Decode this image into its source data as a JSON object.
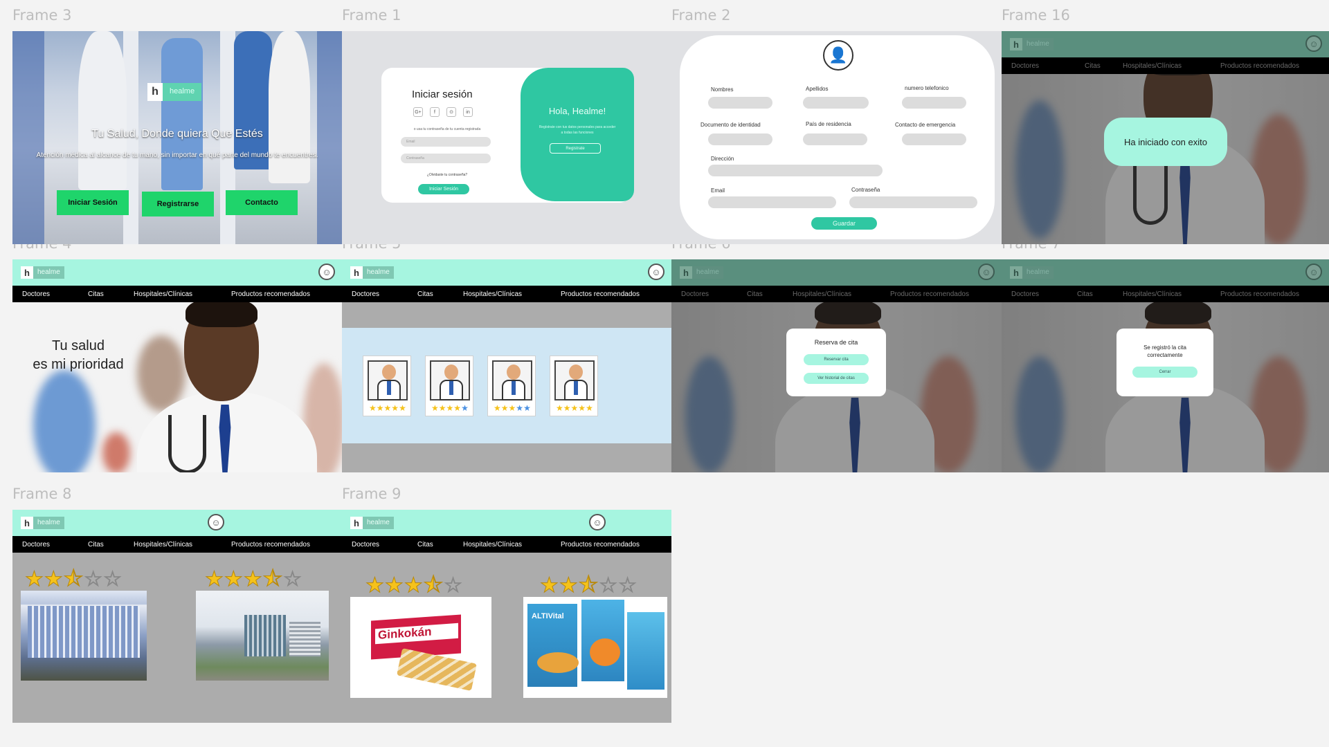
{
  "frame_labels": {
    "f3": "Frame 3",
    "f1": "Frame 1",
    "f2": "Frame 2",
    "f16": "Frame 16",
    "f4": "Frame 4",
    "f5": "Frame 5",
    "f6": "Frame 6",
    "f7": "Frame 7",
    "f8": "Frame 8",
    "f9": "Frame 9"
  },
  "brand": {
    "logo_mark": "h",
    "logo_text": "healme"
  },
  "nav": {
    "doctores": "Doctores",
    "citas": "Citas",
    "hospitales": "Hospitales/Clínicas",
    "productos": "Productos recomendados"
  },
  "landing": {
    "headline": "Tu Salud, Donde quiera Que Estés",
    "subtitle": "Atención médica al alcance de tu mano, sin importar en qué parte del mundo te encuentres.",
    "btn_login": "Iniciar Sesión",
    "btn_register": "Registrarse",
    "btn_contact": "Contacto"
  },
  "login": {
    "title": "Iniciar sesión",
    "social": [
      "G+",
      "f",
      "⊙",
      "in"
    ],
    "hint": "o usa tu contraseña de tu cuenta registrada",
    "email_placeholder": "Email",
    "password_placeholder": "Contraseña",
    "forgot": "¿Olvidaste tu contraseña?",
    "submit": "Iniciar Sesión",
    "panel_title": "Hola, Healme!",
    "panel_text": "Regístrate con tus datos personales para acceder a todas las funciones",
    "panel_button": "Registrate"
  },
  "register": {
    "fields": {
      "nombres": "Nombres",
      "apellidos": "Apellidos",
      "telefono": "numero telefonico",
      "documento": "Documento de identidad",
      "pais": "País de residencia",
      "contacto": "Contacto de emergencia",
      "direccion": "Dirección",
      "email": "Email",
      "contrasena": "Contraseña"
    },
    "submit": "Guardar"
  },
  "success_login": "Ha iniciado con exito",
  "hero": {
    "line1": "Tu salud",
    "line2": "es mi prioridad"
  },
  "doctors": [
    {
      "rating": 5
    },
    {
      "rating": 4
    },
    {
      "rating": 3
    },
    {
      "rating": 5
    }
  ],
  "booking": {
    "title": "Reserva de cita",
    "btn_reserve": "Reservar cita",
    "btn_history": "Ver historial de citas"
  },
  "confirm": {
    "message": "Se registró la cita correctamente",
    "btn": "Cerrar"
  },
  "hospitals": [
    {
      "rating": 2.5
    },
    {
      "rating": 3.5
    }
  ],
  "products": [
    {
      "rating": 3.5,
      "name": "Ginkokán"
    },
    {
      "rating": 2.5,
      "name": "ALTIVital"
    }
  ],
  "colors": {
    "mint": "#a6f5e0",
    "teal": "#2fc7a2",
    "green": "#1fd46b",
    "nav": "#000000",
    "star": "#f5c21b"
  }
}
